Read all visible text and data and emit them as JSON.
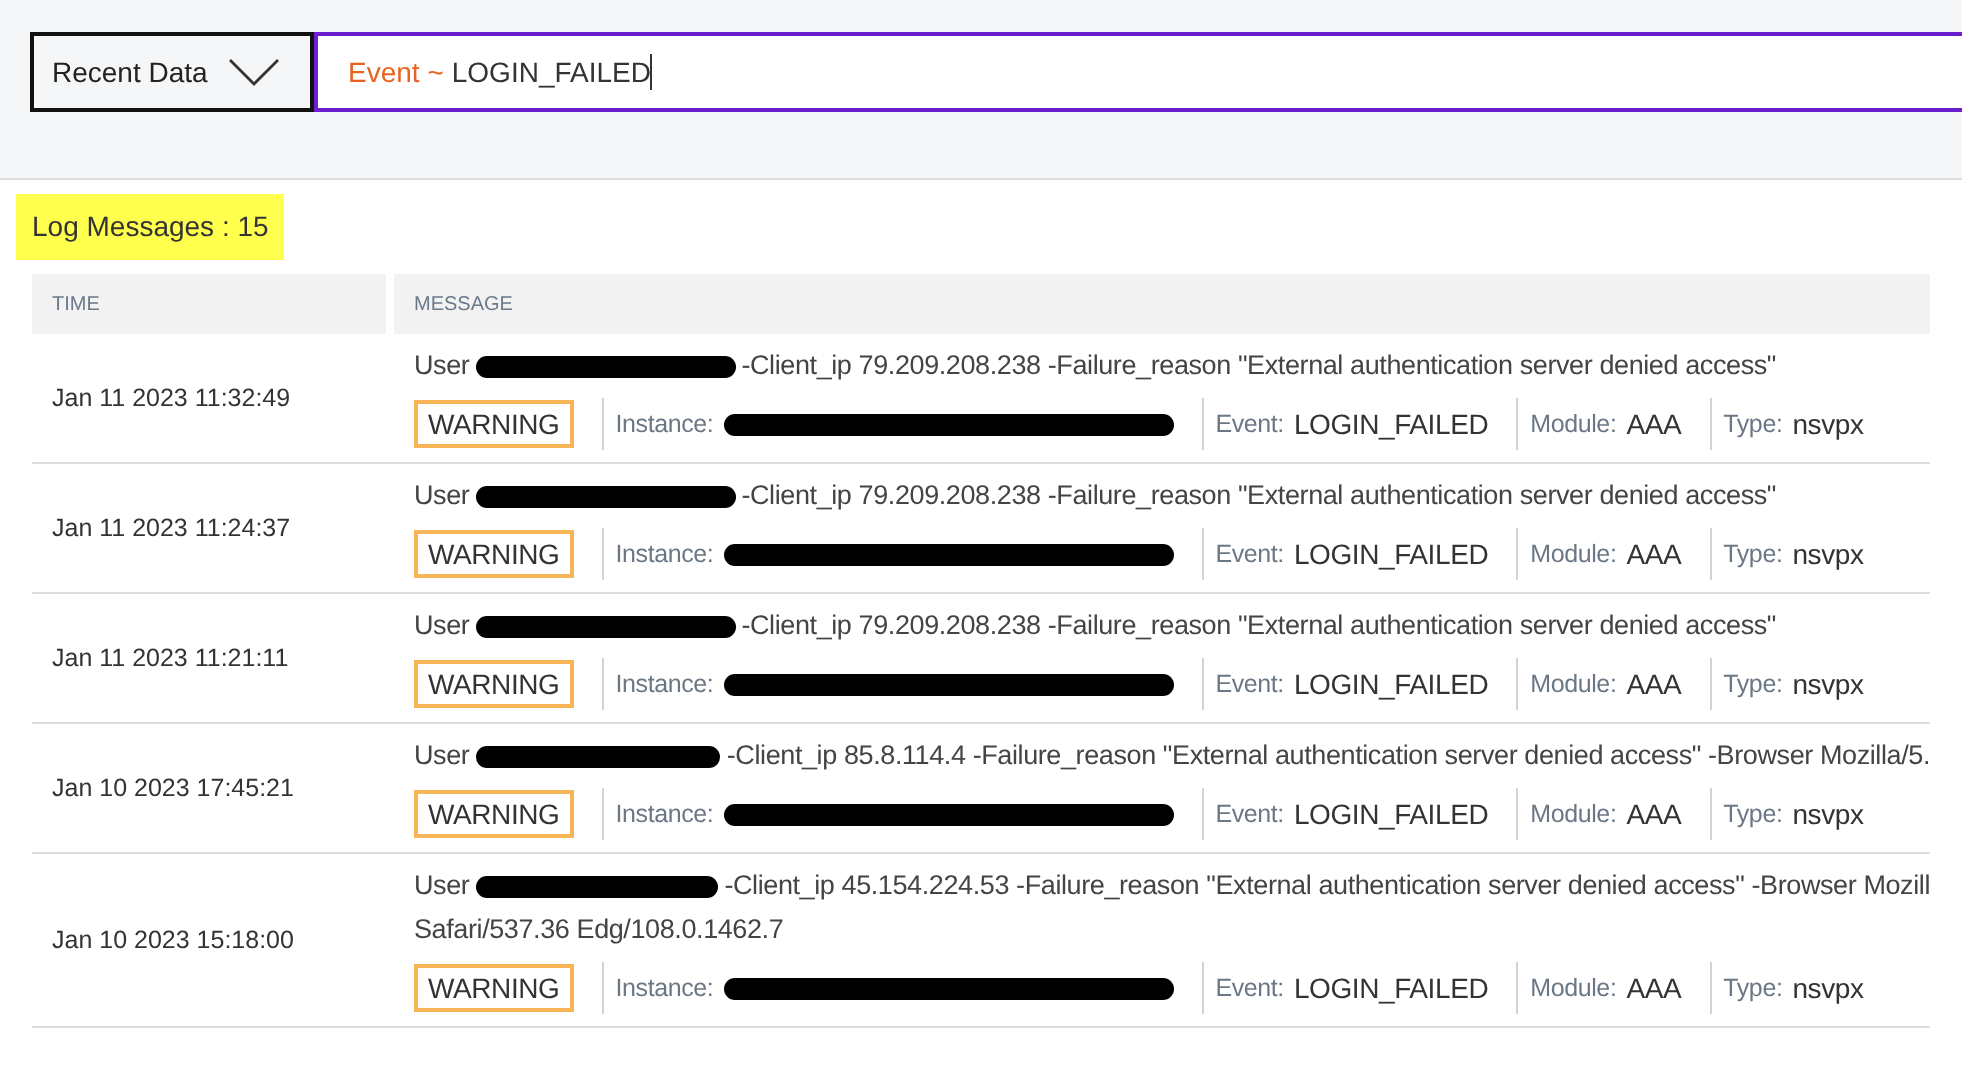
{
  "filter": {
    "range": "Recent Data",
    "query_key": "Event ~",
    "query_value": "LOGIN_FAILED"
  },
  "log_count": "Log Messages : 15",
  "table": {
    "columns": [
      "TIME",
      "MESSAGE"
    ],
    "rows": [
      {
        "time": "Jan 11 2023 11:32:49",
        "user_label": "User",
        "user_redacted": true,
        "message_lines": [
          "-Client_ip 79.209.208.238 -Failure_reason \"External authentication server denied access\""
        ],
        "severity": "WARNING",
        "fields": [
          {
            "label": "Instance:",
            "redacted": true
          },
          {
            "label": "Event:",
            "value": "LOGIN_FAILED"
          },
          {
            "label": "Module:",
            "value": "AAA"
          },
          {
            "label": "Type:",
            "value": "nsvpx"
          }
        ]
      },
      {
        "time": "Jan 11 2023 11:24:37",
        "user_label": "User",
        "user_redacted": true,
        "message_lines": [
          "-Client_ip 79.209.208.238 -Failure_reason \"External authentication server denied access\""
        ],
        "severity": "WARNING",
        "fields": [
          {
            "label": "Instance:",
            "redacted": true
          },
          {
            "label": "Event:",
            "value": "LOGIN_FAILED"
          },
          {
            "label": "Module:",
            "value": "AAA"
          },
          {
            "label": "Type:",
            "value": "nsvpx"
          }
        ]
      },
      {
        "time": "Jan 11 2023 11:21:11",
        "user_label": "User",
        "user_redacted": true,
        "message_lines": [
          "-Client_ip 79.209.208.238 -Failure_reason \"External authentication server denied access\""
        ],
        "severity": "WARNING",
        "fields": [
          {
            "label": "Instance:",
            "redacted": true
          },
          {
            "label": "Event:",
            "value": "LOGIN_FAILED"
          },
          {
            "label": "Module:",
            "value": "AAA"
          },
          {
            "label": "Type:",
            "value": "nsvpx"
          }
        ]
      },
      {
        "time": "Jan 10 2023 17:45:21",
        "user_label": "User",
        "user_redacted": true,
        "message_lines": [
          "-Client_ip 85.8.114.4 -Failure_reason \"External authentication server denied access\" -Browser Mozilla/5."
        ],
        "severity": "WARNING",
        "fields": [
          {
            "label": "Instance:",
            "redacted": true
          },
          {
            "label": "Event:",
            "value": "LOGIN_FAILED"
          },
          {
            "label": "Module:",
            "value": "AAA"
          },
          {
            "label": "Type:",
            "value": "nsvpx"
          }
        ]
      },
      {
        "time": "Jan 10 2023 15:18:00",
        "user_label": "User",
        "user_redacted": true,
        "message_lines": [
          "-Client_ip 45.154.224.53 -Failure_reason \"External authentication server denied access\" -Browser Mozill",
          "Safari/537.36 Edg/108.0.1462.7"
        ],
        "severity": "WARNING",
        "fields": [
          {
            "label": "Instance:",
            "redacted": true
          },
          {
            "label": "Event:",
            "value": "LOGIN_FAILED"
          },
          {
            "label": "Module:",
            "value": "AAA"
          },
          {
            "label": "Type:",
            "value": "nsvpx"
          }
        ]
      }
    ]
  }
}
